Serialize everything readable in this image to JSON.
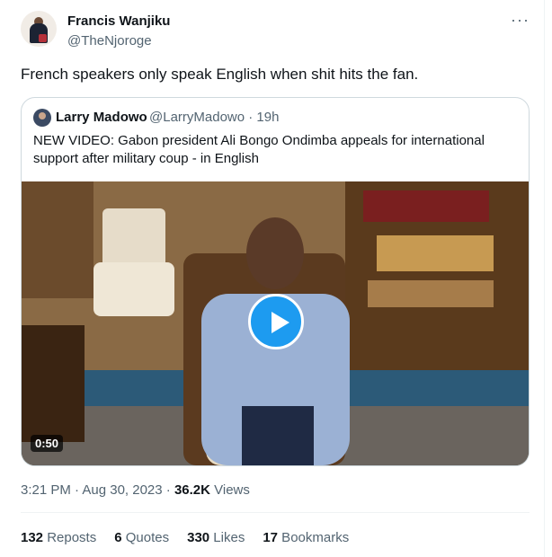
{
  "author": {
    "name": "Francis Wanjiku",
    "handle": "@TheNjoroge"
  },
  "tweet": {
    "text": "French speakers only speak English when shit hits the fan."
  },
  "more_icon": "more-horizontal-icon",
  "quote": {
    "name": "Larry Madowo",
    "handle_time": "@LarryMadowo · 19h",
    "text": "NEW VIDEO: Gabon president Ali Bongo Ondimba appeals for international support after military coup - in English",
    "video": {
      "duration": "0:50",
      "play_icon": "play-icon"
    }
  },
  "meta": {
    "time_date": "3:21 PM · Aug 30, 2023 · ",
    "views_count": "36.2K",
    "views_label": " Views"
  },
  "stats": [
    {
      "count": "132",
      "label": " Reposts"
    },
    {
      "count": "6",
      "label": " Quotes"
    },
    {
      "count": "330",
      "label": " Likes"
    },
    {
      "count": "17",
      "label": " Bookmarks"
    }
  ],
  "colors": {
    "accent": "#1d9bf0",
    "text": "#0f1419",
    "muted": "#536471",
    "border": "#cfd9de"
  }
}
